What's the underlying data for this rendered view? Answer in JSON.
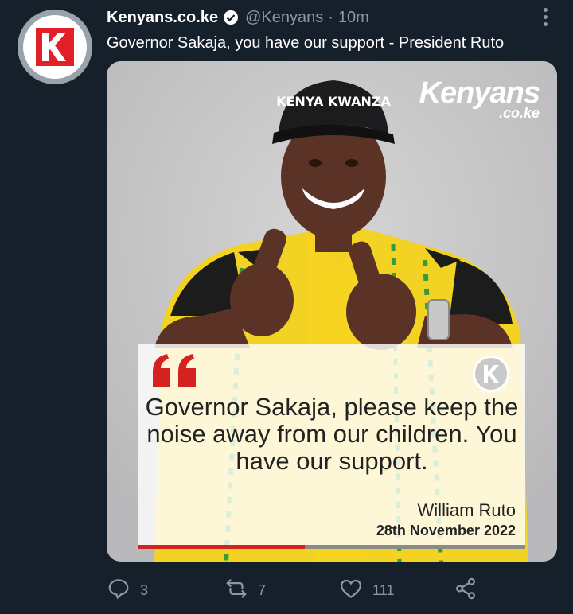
{
  "tweet": {
    "display_name": "Kenyans.co.ke",
    "handle": "@Kenyans",
    "separator": "·",
    "time": "10m",
    "text": "Governor Sakaja, you have our support - President Ruto"
  },
  "media": {
    "brand_main": "Kenyans",
    "brand_sub": ".co.ke",
    "cap_text": "KENYA KWANZA",
    "quote": "Governor Sakaja, please keep the noise away from our children. You have our support.",
    "author": "William Ruto",
    "date": "28th November 2022",
    "progress": 0.43
  },
  "actions": {
    "replies": "3",
    "retweets": "7",
    "likes": "111"
  },
  "colors": {
    "background": "#15202b",
    "muted": "#8b98a5",
    "brand_red": "#d4231e"
  },
  "icons": [
    "verified-badge-icon",
    "more-options-icon",
    "reply-icon",
    "retweet-icon",
    "like-icon",
    "share-icon"
  ]
}
